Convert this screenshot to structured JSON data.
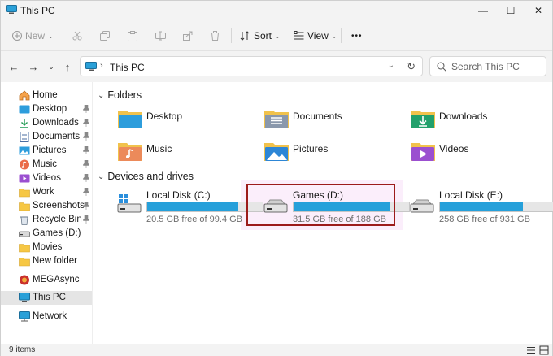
{
  "window": {
    "title": "This PC",
    "controls": {
      "minimize": "—",
      "maximize": "☐",
      "close": "✕"
    }
  },
  "toolbar": {
    "new_label": "New",
    "sort_label": "Sort",
    "view_label": "View",
    "more_label": "•••"
  },
  "address": {
    "path": "This PC"
  },
  "search": {
    "placeholder": "Search This PC"
  },
  "sidebar": {
    "items": [
      {
        "label": "Home",
        "icon": "home-icon",
        "pinned": false
      },
      {
        "label": "Desktop",
        "icon": "desktop-folder-icon",
        "pinned": true
      },
      {
        "label": "Downloads",
        "icon": "downloads-icon",
        "pinned": true
      },
      {
        "label": "Documents",
        "icon": "documents-icon",
        "pinned": true
      },
      {
        "label": "Pictures",
        "icon": "pictures-icon",
        "pinned": true
      },
      {
        "label": "Music",
        "icon": "music-icon",
        "pinned": true
      },
      {
        "label": "Videos",
        "icon": "videos-icon",
        "pinned": true
      },
      {
        "label": "Work",
        "icon": "folder-icon",
        "pinned": true
      },
      {
        "label": "Screenshots",
        "icon": "folder-icon",
        "pinned": true
      },
      {
        "label": "Recycle Bin",
        "icon": "recycle-bin-icon",
        "pinned": true
      },
      {
        "label": "Games (D:)",
        "icon": "drive-icon",
        "pinned": false
      },
      {
        "label": "Movies",
        "icon": "folder-icon",
        "pinned": false
      },
      {
        "label": "New folder",
        "icon": "folder-icon",
        "pinned": false
      },
      {
        "label": "MEGAsync",
        "icon": "mega-icon",
        "pinned": false
      },
      {
        "label": "This PC",
        "icon": "pc-icon",
        "pinned": false,
        "selected": true
      },
      {
        "label": "Network",
        "icon": "network-icon",
        "pinned": false
      }
    ]
  },
  "sections": {
    "folders": "Folders",
    "drives": "Devices and drives"
  },
  "folders": [
    {
      "label": "Desktop",
      "icon": "desktop-folder-icon"
    },
    {
      "label": "Documents",
      "icon": "documents-folder-icon"
    },
    {
      "label": "Downloads",
      "icon": "downloads-folder-icon"
    },
    {
      "label": "Music",
      "icon": "music-folder-icon"
    },
    {
      "label": "Pictures",
      "icon": "pictures-folder-icon"
    },
    {
      "label": "Videos",
      "icon": "videos-folder-icon"
    }
  ],
  "drives": [
    {
      "name": "Local Disk (C:)",
      "free": "20.5 GB free of 99.4 GB",
      "used_fraction": 0.79,
      "icon": "windows-drive-icon"
    },
    {
      "name": "Games (D:)",
      "free": "31.5 GB free of 188 GB",
      "used_fraction": 0.83,
      "icon": "drive-icon",
      "highlighted": true
    },
    {
      "name": "Local Disk (E:)",
      "free": "258 GB free of 931 GB",
      "used_fraction": 0.72,
      "icon": "drive-icon"
    }
  ],
  "status": {
    "count": "9 items"
  },
  "colors": {
    "drive_fill": "#26a0da",
    "highlight_border": "#9c1b1b",
    "accent": "#0067c0"
  }
}
